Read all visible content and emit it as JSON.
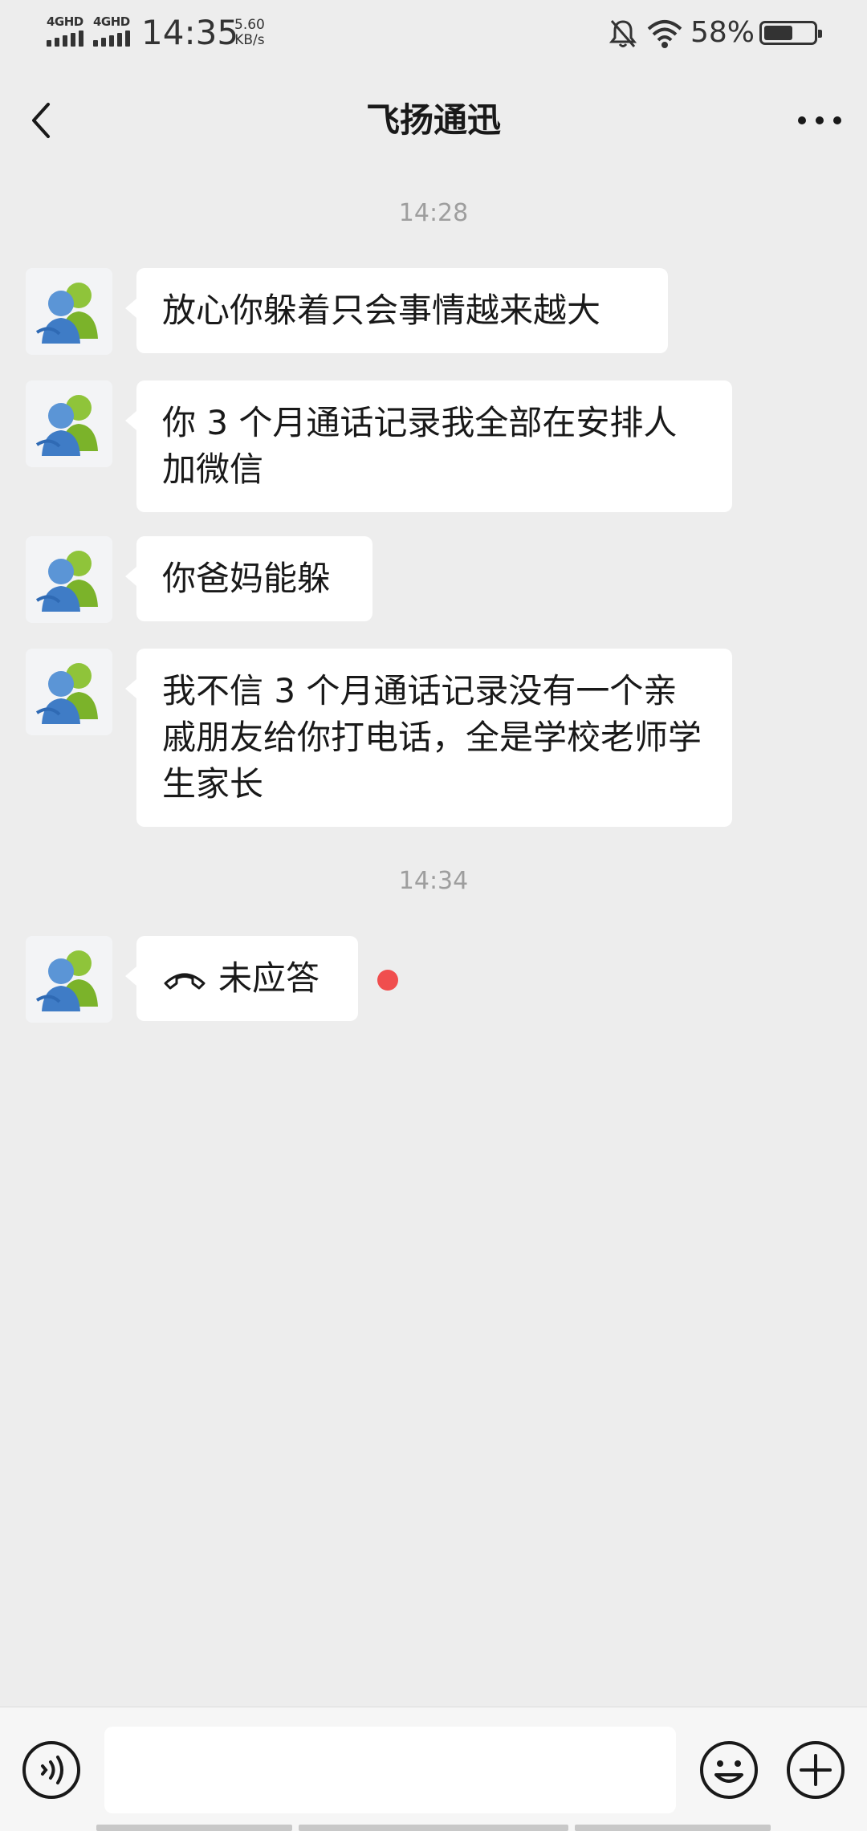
{
  "status_bar": {
    "sim1": "4GHD",
    "sim2": "4GHD",
    "time": "14:35",
    "net_speed_value": "5.60",
    "net_speed_unit": "KB/s",
    "battery_percent_text": "58%",
    "battery_level": 0.58,
    "icons": [
      "signal-icon",
      "mute-bell-icon",
      "wifi-icon",
      "battery-icon"
    ]
  },
  "header": {
    "title": "飞扬通迅",
    "back_icon": "chevron-left-icon",
    "more_icon": "more-dots-icon"
  },
  "messages": [
    {
      "type": "timestamp",
      "text": "14:28"
    },
    {
      "type": "incoming",
      "text": "放心你躲着只会事情越来越大"
    },
    {
      "type": "incoming",
      "text": "你 3 个月通话记录我全部在安排人加微信"
    },
    {
      "type": "incoming",
      "text": "你爸妈能躲"
    },
    {
      "type": "incoming",
      "text": "我不信 3 个月通话记录没有一个亲戚朋友给你打电话，全是学校老师学生家长"
    },
    {
      "type": "timestamp",
      "text": "14:34"
    },
    {
      "type": "call",
      "text": "未应答",
      "unread": true
    }
  ],
  "input_bar": {
    "voice_icon": "voice-icon",
    "emoji_icon": "emoji-icon",
    "plus_icon": "plus-icon",
    "input_value": ""
  },
  "colors": {
    "background": "#ededed",
    "bubble": "#ffffff",
    "timestamp": "#9e9e9e",
    "unread_dot": "#f04e4e"
  }
}
